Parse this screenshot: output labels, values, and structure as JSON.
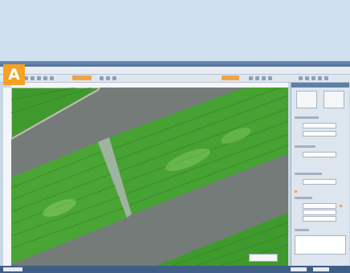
{
  "panel_label": "A",
  "colors": {
    "label_bg": "#f4a224",
    "crop_green": "#3f9a2e",
    "road_gray": "#747b79",
    "window_chrome": "#4f6f99"
  }
}
